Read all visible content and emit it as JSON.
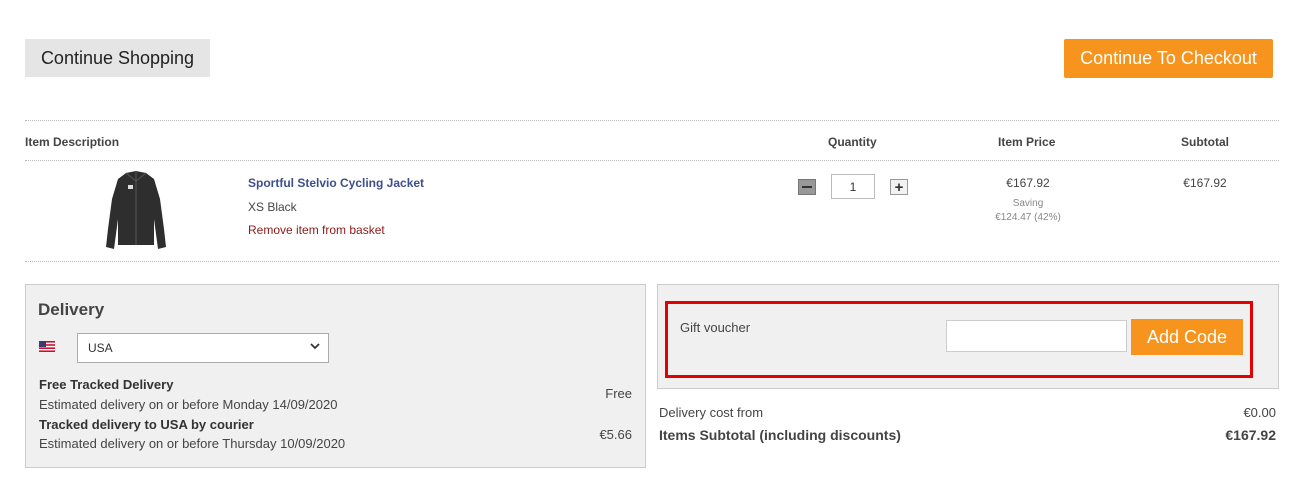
{
  "top_actions": {
    "continue_shopping": "Continue Shopping",
    "checkout": "Continue To Checkout"
  },
  "table": {
    "headers": {
      "item_description": "Item Description",
      "quantity": "Quantity",
      "item_price": "Item Price",
      "subtotal": "Subtotal"
    },
    "rows": [
      {
        "name": "Sportful Stelvio Cycling Jacket",
        "variant": "XS Black",
        "remove": "Remove item from basket",
        "quantity": "1",
        "price": "€167.92",
        "saving_label": "Saving",
        "saving_value": "€124.47 (42%)",
        "subtotal": "€167.92",
        "image_icon": "cycling-jacket-image"
      }
    ]
  },
  "delivery": {
    "title": "Delivery",
    "country_flag_icon": "usa-flag-icon",
    "country": "USA",
    "options": [
      {
        "title": "Free Tracked Delivery",
        "desc": "Estimated delivery on or before Monday 14/09/2020",
        "price": "Free"
      },
      {
        "title": "Tracked delivery to USA by courier",
        "desc": "Estimated delivery on or before Thursday 10/09/2020",
        "price": "€5.66"
      }
    ]
  },
  "voucher": {
    "label": "Gift voucher",
    "input_value": "",
    "button": "Add Code"
  },
  "summary": {
    "delivery_label": "Delivery cost from",
    "delivery_value": "€0.00",
    "subtotal_label": "Items Subtotal (including discounts)",
    "subtotal_value": "€167.92"
  },
  "colors": {
    "accent": "#f7941d",
    "link_blue": "#3d4f8c",
    "remove_red": "#8b1a1a",
    "highlight_red": "#e30000"
  }
}
